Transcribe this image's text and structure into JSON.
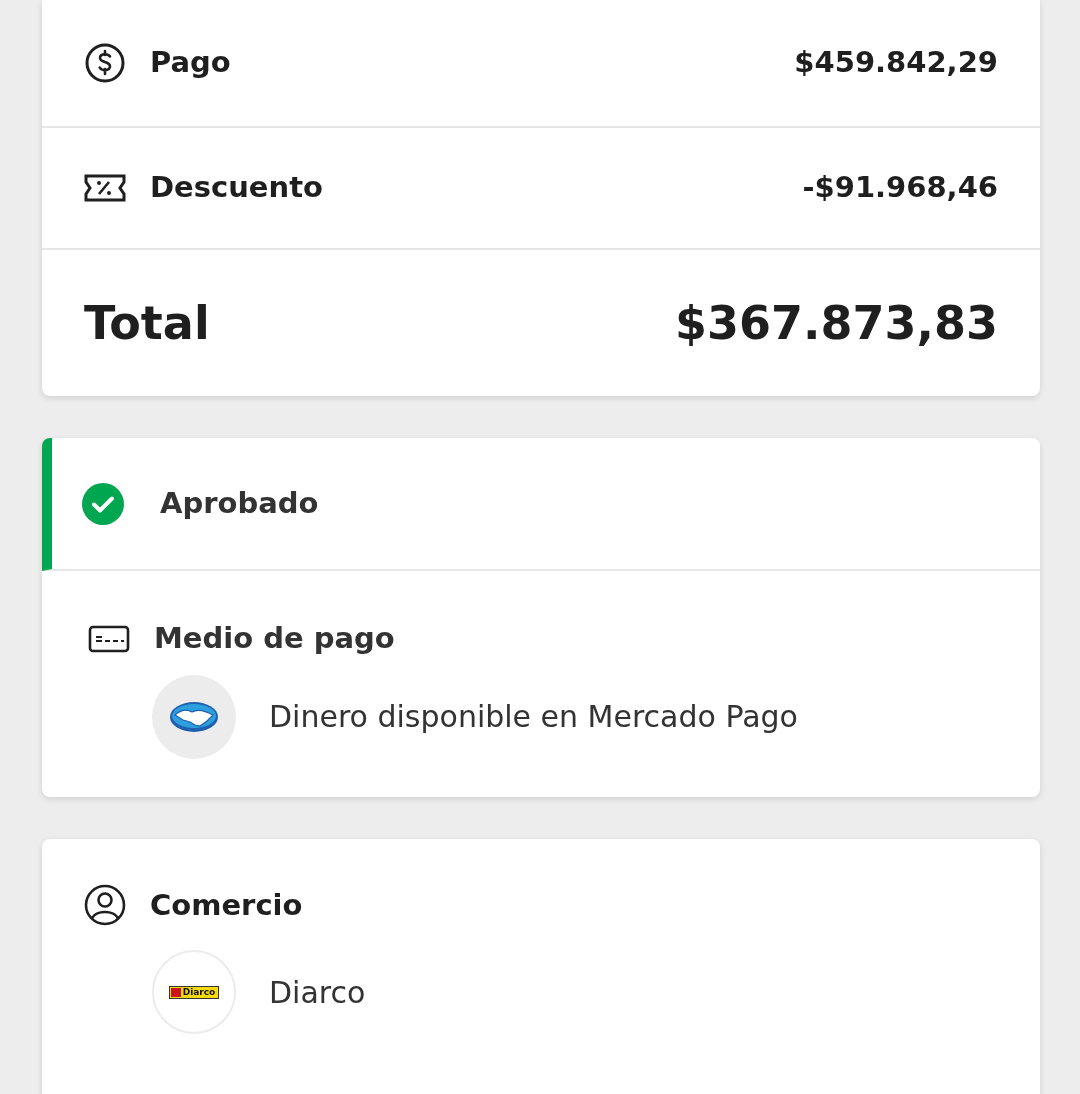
{
  "summary": {
    "rows": [
      {
        "kind": "payment",
        "label": "Pago",
        "amount": "$459.842,29"
      },
      {
        "kind": "discount",
        "label": "Descuento",
        "amount": "-$91.968,46"
      }
    ],
    "total": {
      "label": "Total",
      "amount": "$367.873,83"
    }
  },
  "status": {
    "kind": "approved",
    "label": "Aprobado"
  },
  "payment_method": {
    "title": "Medio de pago",
    "name": "Dinero disponible en Mercado Pago"
  },
  "merchant": {
    "title": "Comercio",
    "name": "Diarco",
    "logo_text": "Diarco"
  }
}
